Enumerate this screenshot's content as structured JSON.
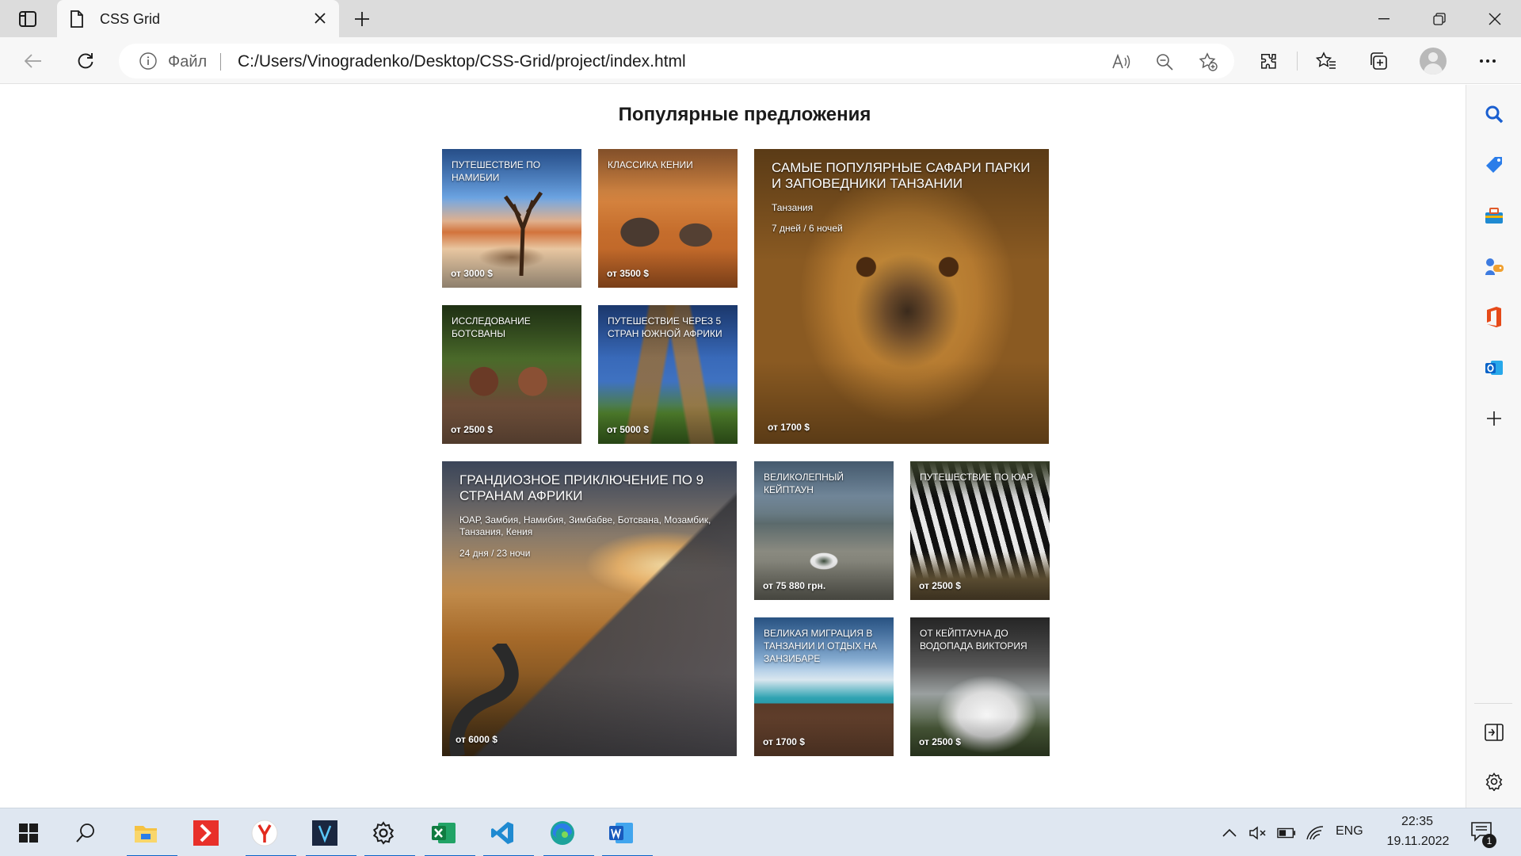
{
  "browser": {
    "tab_title": "CSS Grid",
    "omnibox": {
      "scheme_label": "Файл",
      "url": "C:/Users/Vinogradenko/Desktop/CSS-Grid/project/index.html"
    }
  },
  "page": {
    "heading": "Популярные предложения",
    "cards": {
      "namibia": {
        "title": "Путешествие по Намибии",
        "price": "от 3000 $"
      },
      "kenya": {
        "title": "Классика Кении",
        "price": "от 3500 $"
      },
      "tanzania": {
        "title": "Самые популярные сафари парки и заповедники Танзании",
        "country": "Танзания",
        "duration": "7 дней / 6 ночей",
        "price": "от 1700 $"
      },
      "botswana": {
        "title": "Исследование Ботсваны",
        "price": "от 2500 $"
      },
      "five_countries": {
        "title": "Путешествие через 5 стран Южной Африки",
        "price": "от 5000 $"
      },
      "africa9": {
        "title": "Грандиозное приключение по 9 странам Африки",
        "countries": "ЮАР, Замбия, Намибия, Зимбабве, Ботсвана, Мозамбик, Танзания, Кения",
        "duration": "24 дня / 23 ночи",
        "price": "от 6000 $"
      },
      "capetown": {
        "title": "Великолепный Кейптаун",
        "price": "от 75 880 грн."
      },
      "sar": {
        "title": "Путешествие по ЮАР",
        "price": "от 2500 $"
      },
      "migration": {
        "title": "Великая миграция в Танзании и отдых на Занзибаре",
        "price": "от 1700 $"
      },
      "victoria": {
        "title": "От Кейптауна до водопада Виктория",
        "price": "от 2500 $"
      }
    }
  },
  "taskbar": {
    "language": "ENG",
    "time": "22:35",
    "date": "19.11.2022",
    "notification_count": "1"
  },
  "colors": {
    "accent": "#0a64c8",
    "chrome_bg": "#f7f7f7",
    "tabbar_bg": "#dcdcdc",
    "taskbar_bg": "#dfe7f1"
  }
}
